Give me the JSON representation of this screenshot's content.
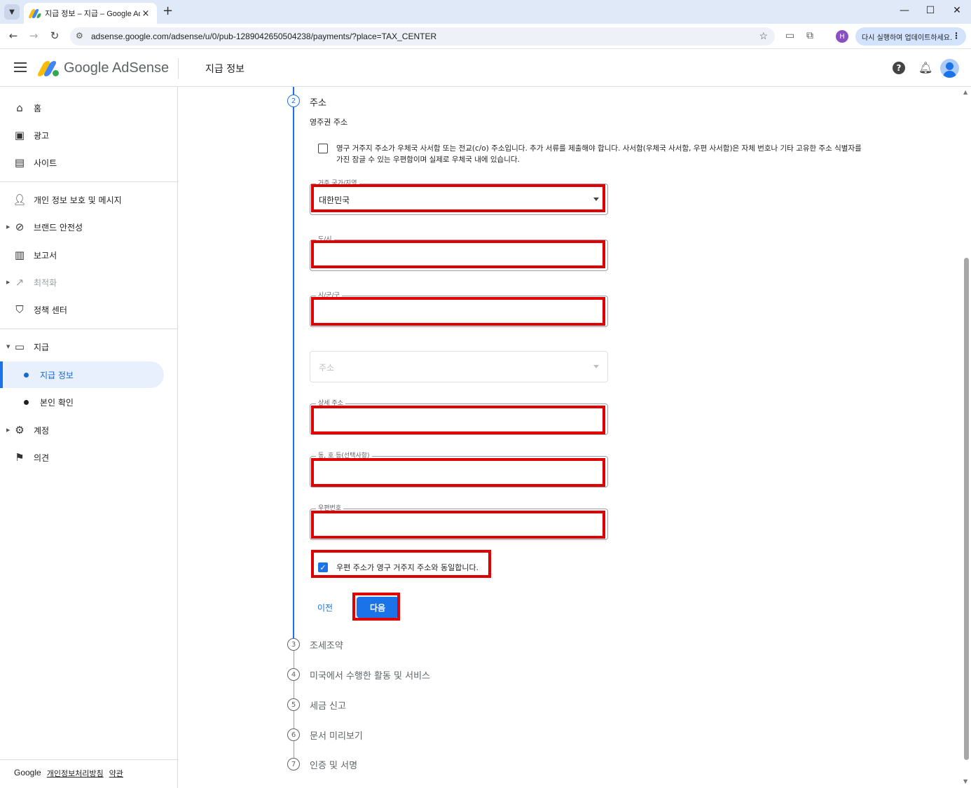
{
  "browser": {
    "tab_title": "지급 정보 – 지급 – Google Ad",
    "url": "adsense.google.com/adsense/u/0/pub-1289042650504238/payments/?place=TAX_CENTER",
    "profile_initial": "H",
    "update_label": "다시 실행하여 업데이트하세요."
  },
  "header": {
    "logo_text": "Google AdSense",
    "page_title": "지급 정보"
  },
  "sidebar": {
    "items": [
      {
        "label": "홈",
        "icon": "home-icon"
      },
      {
        "label": "광고",
        "icon": "ads-icon"
      },
      {
        "label": "사이트",
        "icon": "sites-icon"
      },
      {
        "label": "개인 정보 보호 및 메시지",
        "icon": "privacy-icon"
      },
      {
        "label": "브랜드 안전성",
        "icon": "block-icon"
      },
      {
        "label": "보고서",
        "icon": "report-icon"
      },
      {
        "label": "최적화",
        "icon": "trending-icon"
      },
      {
        "label": "정책 센터",
        "icon": "policy-icon"
      },
      {
        "label": "지급",
        "icon": "payments-icon"
      },
      {
        "label": "계정",
        "icon": "gear-icon"
      },
      {
        "label": "의견",
        "icon": "feedback-icon"
      }
    ],
    "sub_items": [
      {
        "label": "지급 정보"
      },
      {
        "label": "본인 확인"
      }
    ],
    "footer": {
      "brand": "Google",
      "privacy": "개인정보처리방침",
      "terms": "약관"
    }
  },
  "form": {
    "active_step_number": "2",
    "active_step_label": "주소",
    "section_title": "영주권 주소",
    "po_box_checkbox_text": "영구 거주지 주소가 우체국 사서함 또는 전교(c/o) 주소입니다. 추가 서류를 제출해야 합니다. 사서함(우체국 사서함, 우편 사서함)은 자체 번호나 기타 고유한 주소 식별자를 가진 잠글 수 있는 우편함이며 실제로 우체국 내에 있습니다.",
    "po_box_checked": false,
    "fields": {
      "country": {
        "label": "거주 국가/지역",
        "value": "대한민국"
      },
      "city": {
        "label": "도/시",
        "value": ""
      },
      "district": {
        "label": "시/군/구",
        "value": ""
      },
      "address": {
        "placeholder": "주소"
      },
      "detail": {
        "label": "상세 주소",
        "value": ""
      },
      "unit": {
        "label": "동, 호 등(선택사항)",
        "value": ""
      },
      "postal": {
        "label": "우편번호",
        "value": ""
      }
    },
    "same_address_text": "우편 주소가 영구 거주지 주소와 동일합니다.",
    "same_address_checked": true,
    "prev_label": "이전",
    "next_label": "다음"
  },
  "steps": [
    {
      "number": "3",
      "label": "조세조약"
    },
    {
      "number": "4",
      "label": "미국에서 수행한 활동 및 서비스"
    },
    {
      "number": "5",
      "label": "세금 신고"
    },
    {
      "number": "6",
      "label": "문서 미리보기"
    },
    {
      "number": "7",
      "label": "인증 및 서명"
    }
  ],
  "colors": {
    "accent": "#1a73e8",
    "highlight": "#e00000"
  }
}
